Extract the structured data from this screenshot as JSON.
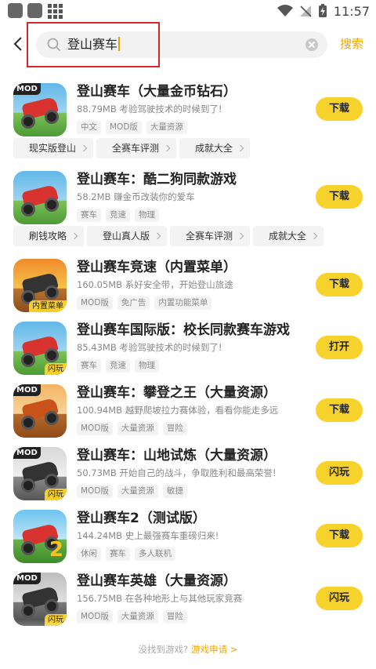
{
  "status_bar": {
    "time": "11:57"
  },
  "search": {
    "query": "登山赛车",
    "search_label": "搜索"
  },
  "apps": [
    {
      "title": "登山赛车（大量金币钻石）",
      "desc": "88.79MB 考验驾驶技术的时候到了!",
      "tags": [
        "中文",
        "MOD版",
        "大量资源"
      ],
      "action": "下载",
      "badge_top": "MOD",
      "badge_corner": ""
    },
    {
      "title": "登山赛车：酷二狗同款游戏",
      "desc": "58.2MB 赚金币改装你的爱车",
      "tags": [
        "赛车",
        "竞速",
        "物理"
      ],
      "action": "下载",
      "badge_top": "",
      "badge_corner": ""
    },
    {
      "title": "登山赛车竞速（内置菜单）",
      "desc": "160.05MB 系好安全带，开始登山旅途",
      "tags": [
        "MOD版",
        "免广告",
        "内置功能菜单"
      ],
      "action": "下载",
      "badge_top": "",
      "badge_corner": "内置菜单"
    },
    {
      "title": "登山赛车国际版：校长同款赛车游戏",
      "desc": "85.43MB 考验驾驶技术的时候到了!",
      "tags": [
        "赛车",
        "竞速",
        "物理"
      ],
      "action": "打开",
      "badge_top": "",
      "badge_corner": "闪玩"
    },
    {
      "title": "登山赛车：攀登之王（大量资源）",
      "desc": "100.94MB 越野爬坡拉力赛体验，看看你能走多远",
      "tags": [
        "MOD版",
        "大量资源",
        "冒险"
      ],
      "action": "下载",
      "badge_top": "MOD",
      "badge_corner": ""
    },
    {
      "title": "登山赛车：山地试炼（大量资源）",
      "desc": "50.73MB 开始自己的战斗，争取胜利和最高荣誉!",
      "tags": [
        "MOD版",
        "大量资源",
        "敏捷"
      ],
      "action": "闪玩",
      "badge_top": "MOD",
      "badge_corner": "闪玩"
    },
    {
      "title": "登山赛车2（测试版）",
      "desc": "144.24MB 史上最强赛车重磅归来!",
      "tags": [
        "休闲",
        "赛车",
        "多人联机"
      ],
      "action": "下载",
      "badge_top": "",
      "badge_corner": ""
    },
    {
      "title": "登山赛车英雄（大量资源）",
      "desc": "156.75MB 在各种地形上与其他玩家竞赛",
      "tags": [
        "MOD版",
        "大量资源",
        "冒险"
      ],
      "action": "闪玩",
      "badge_top": "MOD",
      "badge_corner": "闪玩"
    }
  ],
  "chips_row1": [
    "现实版登山",
    "全赛车评测",
    "成就大全"
  ],
  "chips_row2": [
    "刷钱攻略",
    "登山真人版",
    "全赛车评测",
    "成就大全"
  ],
  "footer": {
    "text": "没找到游戏?",
    "link": "游戏申请 >"
  },
  "colors": {
    "accent": "#f8d22c",
    "link": "#f0a500",
    "highlight_box": "#d8262c"
  }
}
